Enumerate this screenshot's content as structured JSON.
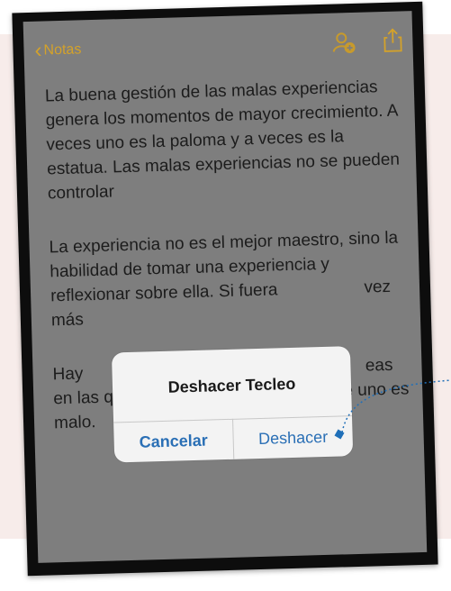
{
  "nav": {
    "back_label": "Notas"
  },
  "icons": {
    "add_person": "person-add-icon",
    "share": "share-icon"
  },
  "colors": {
    "accent": "#d4a22a",
    "button": "#2a6fb5",
    "background": "#f7ecea"
  },
  "note": {
    "paragraphs": [
      "La buena gestión de las malas experiencias genera los momentos de mayor crecimiento. A veces uno es la paloma y a veces es la estatua. Las malas experiencias no se pueden controlar",
      "La experiencia no es el mejor maestro, sino la habilidad de tomar una experiencia y reflexionar sobre ella. Si fuera",
      "vez",
      "más",
      "Hay",
      "eas",
      "en las que uno es bueno, no en las que uno es malo."
    ]
  },
  "alert": {
    "title": "Deshacer Tecleo",
    "cancel_label": "Cancelar",
    "confirm_label": "Deshacer"
  }
}
